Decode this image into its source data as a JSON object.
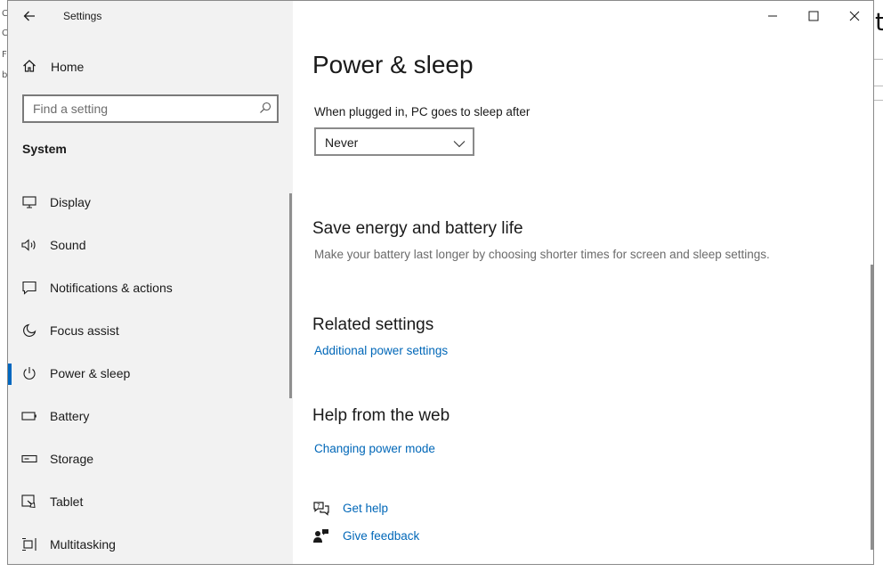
{
  "window": {
    "title": "Settings"
  },
  "sidebar": {
    "home_label": "Home",
    "search_placeholder": "Find a setting",
    "section_label": "System",
    "items": [
      {
        "label": "Display",
        "icon": "monitor-icon"
      },
      {
        "label": "Sound",
        "icon": "speaker-icon"
      },
      {
        "label": "Notifications & actions",
        "icon": "message-icon"
      },
      {
        "label": "Focus assist",
        "icon": "moon-icon"
      },
      {
        "label": "Power & sleep",
        "icon": "power-icon",
        "active": true
      },
      {
        "label": "Battery",
        "icon": "battery-icon"
      },
      {
        "label": "Storage",
        "icon": "storage-icon"
      },
      {
        "label": "Tablet",
        "icon": "tablet-icon"
      },
      {
        "label": "Multitasking",
        "icon": "multitasking-icon"
      }
    ]
  },
  "main": {
    "page_title": "Power & sleep",
    "sleep": {
      "label": "When plugged in, PC goes to sleep after",
      "selected": "Never"
    },
    "save_energy": {
      "heading": "Save energy and battery life",
      "description": "Make your battery last longer by choosing shorter times for screen and sleep settings."
    },
    "related": {
      "heading": "Related settings",
      "link": "Additional power settings"
    },
    "help_web": {
      "heading": "Help from the web",
      "link": "Changing power mode"
    },
    "get_help": "Get help",
    "give_feedback": "Give feedback"
  },
  "colors": {
    "accent": "#0067c0",
    "link": "#0067b8",
    "sidebar_bg": "#f2f2f2"
  }
}
